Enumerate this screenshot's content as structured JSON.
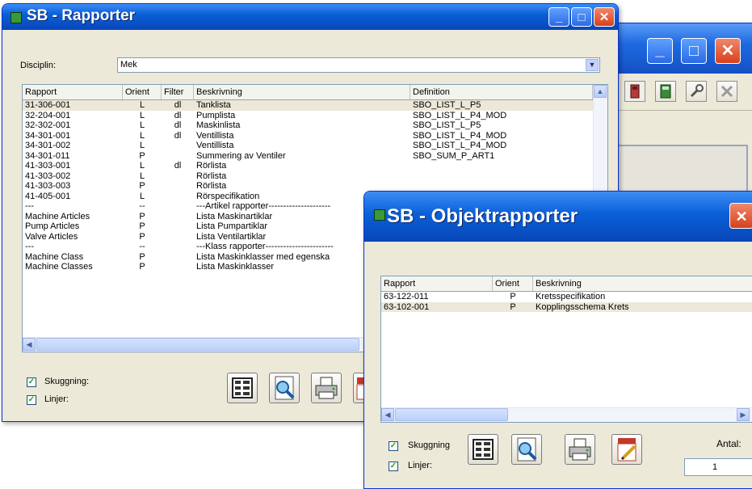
{
  "back_window": {},
  "rapporter": {
    "title": "SB - Rapporter",
    "discipline_label": "Disciplin:",
    "discipline_value": "Mek",
    "columns": [
      "Rapport",
      "Orient",
      "Filter",
      "Beskrivning",
      "Definition"
    ],
    "rows": [
      {
        "rapport": "31-306-001",
        "orient": "L",
        "filter": "dl",
        "beskrivning": "Tanklista",
        "definition": "SBO_LIST_L_P5"
      },
      {
        "rapport": "32-204-001",
        "orient": "L",
        "filter": "dl",
        "beskrivning": "Pumplista",
        "definition": "SBO_LIST_L_P4_MOD"
      },
      {
        "rapport": "32-302-001",
        "orient": "L",
        "filter": "dl",
        "beskrivning": "Maskinlista",
        "definition": "SBO_LIST_L_P5"
      },
      {
        "rapport": "34-301-001",
        "orient": "L",
        "filter": "dl",
        "beskrivning": "Ventillista",
        "definition": "SBO_LIST_L_P4_MOD"
      },
      {
        "rapport": "34-301-002",
        "orient": "L",
        "filter": "",
        "beskrivning": "Ventillista",
        "definition": "SBO_LIST_L_P4_MOD"
      },
      {
        "rapport": "34-301-011",
        "orient": "P",
        "filter": "",
        "beskrivning": "Summering av Ventiler",
        "definition": "SBO_SUM_P_ART1"
      },
      {
        "rapport": "41-303-001",
        "orient": "L",
        "filter": "dl",
        "beskrivning": "Rörlista",
        "definition": ""
      },
      {
        "rapport": "41-303-002",
        "orient": "L",
        "filter": "",
        "beskrivning": "Rörlista",
        "definition": ""
      },
      {
        "rapport": "41-303-003",
        "orient": "P",
        "filter": "",
        "beskrivning": "Rörlista",
        "definition": ""
      },
      {
        "rapport": "41-405-001",
        "orient": "L",
        "filter": "",
        "beskrivning": "Rörspecifikation",
        "definition": ""
      },
      {
        "rapport": "---",
        "orient": "--",
        "filter": "",
        "beskrivning": "---Artikel rapporter---------------------",
        "definition": ""
      },
      {
        "rapport": "Machine Articles",
        "orient": "P",
        "filter": "",
        "beskrivning": "Lista Maskinartiklar",
        "definition": ""
      },
      {
        "rapport": "Pump Articles",
        "orient": "P",
        "filter": "",
        "beskrivning": "Lista Pumpartiklar",
        "definition": ""
      },
      {
        "rapport": "Valve Articles",
        "orient": "P",
        "filter": "",
        "beskrivning": "Lista Ventilartiklar",
        "definition": ""
      },
      {
        "rapport": "---",
        "orient": "--",
        "filter": "",
        "beskrivning": "---Klass rapporter-----------------------",
        "definition": ""
      },
      {
        "rapport": "Machine Class",
        "orient": "P",
        "filter": "",
        "beskrivning": "Lista Maskinklasser med egenska",
        "definition": ""
      },
      {
        "rapport": "Machine Classes",
        "orient": "P",
        "filter": "",
        "beskrivning": "Lista Maskinklasser",
        "definition": ""
      }
    ],
    "skuggning_label": "Skuggning:",
    "linjer_label": "Linjer:",
    "skuggning_checked": true,
    "linjer_checked": true
  },
  "objektrapporter": {
    "title": "SB - Objektrapporter",
    "columns": [
      "Rapport",
      "Orient",
      "Beskrivning"
    ],
    "rows": [
      {
        "rapport": "63-122-011",
        "orient": "P",
        "beskrivning": "Kretsspecifikation"
      },
      {
        "rapport": "63-102-001",
        "orient": "P",
        "beskrivning": "Kopplingsschema Krets"
      }
    ],
    "skuggning_label": "Skuggning",
    "linjer_label": "Linjer:",
    "antal_label": "Antal:",
    "antal_value": "1",
    "skuggning_checked": true,
    "linjer_checked": true
  },
  "glyphs": {
    "minimize": "_",
    "maximize": "□",
    "close": "✕",
    "check": "✓",
    "scroll_up": "▲",
    "scroll_down": "▼",
    "scroll_left": "◀",
    "scroll_right": "▶"
  },
  "colors": {
    "title_bar": "#0a5fd7",
    "close_button": "#d6411d",
    "window_bg": "#ece9d8",
    "selected_row": "#ece7d8"
  }
}
